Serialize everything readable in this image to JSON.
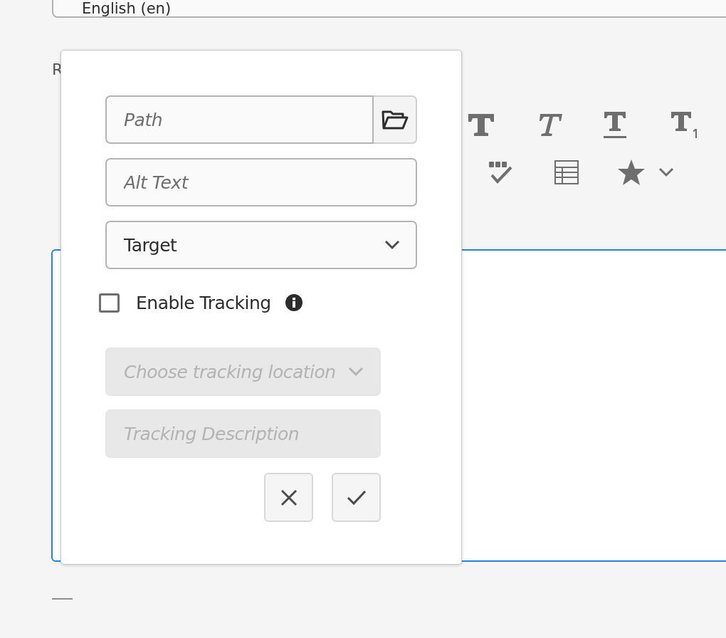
{
  "language_field": {
    "value": "English (en)"
  },
  "section_label": "R",
  "toolbar": [
    {
      "kind": "bold"
    },
    {
      "kind": "italic"
    },
    {
      "kind": "underline"
    },
    {
      "kind": "subscript"
    },
    {
      "kind": "spellcheck"
    },
    {
      "kind": "table"
    },
    {
      "kind": "star"
    },
    {
      "kind": "chevron"
    }
  ],
  "editor": {
    "focused": true
  },
  "popover": {
    "path_field": {
      "placeholder": "Path"
    },
    "alt_text_field": {
      "placeholder": "Alt Text"
    },
    "target_dropdown": {
      "value": "Target"
    },
    "enable_tracking": {
      "label": "Enable Tracking",
      "checked": false
    },
    "tracking_location": {
      "placeholder": "Choose tracking location",
      "disabled": true
    },
    "tracking_description": {
      "placeholder": "Tracking Description",
      "disabled": true
    },
    "buttons": [
      {
        "kind": "cancel"
      },
      {
        "kind": "confirm"
      }
    ]
  }
}
